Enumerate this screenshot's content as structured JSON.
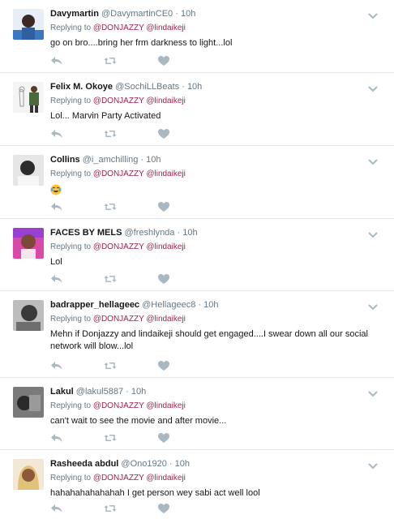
{
  "reply_prefix": "Replying to",
  "dot": "·",
  "tweets": [
    {
      "name": "Davymartin",
      "handle": "@DavymartinCE0",
      "time": "10h",
      "mention1": "@DONJAZZY",
      "mention2": "@lindaikeji",
      "text": "go on bro....bring her frm darkness to light...lol",
      "avatar_color": "#3a78c2"
    },
    {
      "name": "Felix M. Okoye",
      "handle": "@SochiLLBeats",
      "time": "10h",
      "mention1": "@DONJAZZY",
      "mention2": "@lindaikeji",
      "text": "Lol... Marvin Party Activated",
      "avatar_color": "#4a6a3a"
    },
    {
      "name": "Collins",
      "handle": "@i_amchilling",
      "time": "10h",
      "mention1": "@DONJAZZY",
      "mention2": "@lindaikeji",
      "text": "",
      "emoji": "tears-of-joy-emoji",
      "avatar_color": "#cfcfcf"
    },
    {
      "name": "FACES BY MELS",
      "handle": "@freshlynda",
      "time": "10h",
      "mention1": "@DONJAZZY",
      "mention2": "@lindaikeji",
      "text": "Lol",
      "avatar_color": "#c24a9a"
    },
    {
      "name": "badrapper_hellageec",
      "handle": "@Hellageec8",
      "time": "10h",
      "mention1": "@DONJAZZY",
      "mention2": "@lindaikeji",
      "text_lines": [
        "Mehn if Donjazzy and lindaikeji should get engaged....I swear down all our social",
        "network will blow...lol"
      ],
      "avatar_color": "#8a8a8a"
    },
    {
      "name": "Lakul",
      "handle": "@lakul5887",
      "time": "10h",
      "mention1": "@DONJAZZY",
      "mention2": "@lindaikeji",
      "text": "can't wait to see the movie and after movie...",
      "avatar_color": "#555555"
    },
    {
      "name": "Rasheeda abdul",
      "handle": "@Ono1920",
      "time": "10h",
      "mention1": "@DONJAZZY",
      "mention2": "@lindaikeji",
      "text": "hahahahahahahah I get person wey sabi act well lool",
      "avatar_color": "#d9b48a"
    }
  ],
  "colors": {
    "mention": "#a0244b",
    "muted": "#657786",
    "icon": "#aab8c2",
    "divider": "#e1e8ed"
  },
  "icons": {
    "reply": "reply-icon",
    "retweet": "retweet-icon",
    "like": "heart-icon",
    "menu": "chevron-down-icon"
  }
}
